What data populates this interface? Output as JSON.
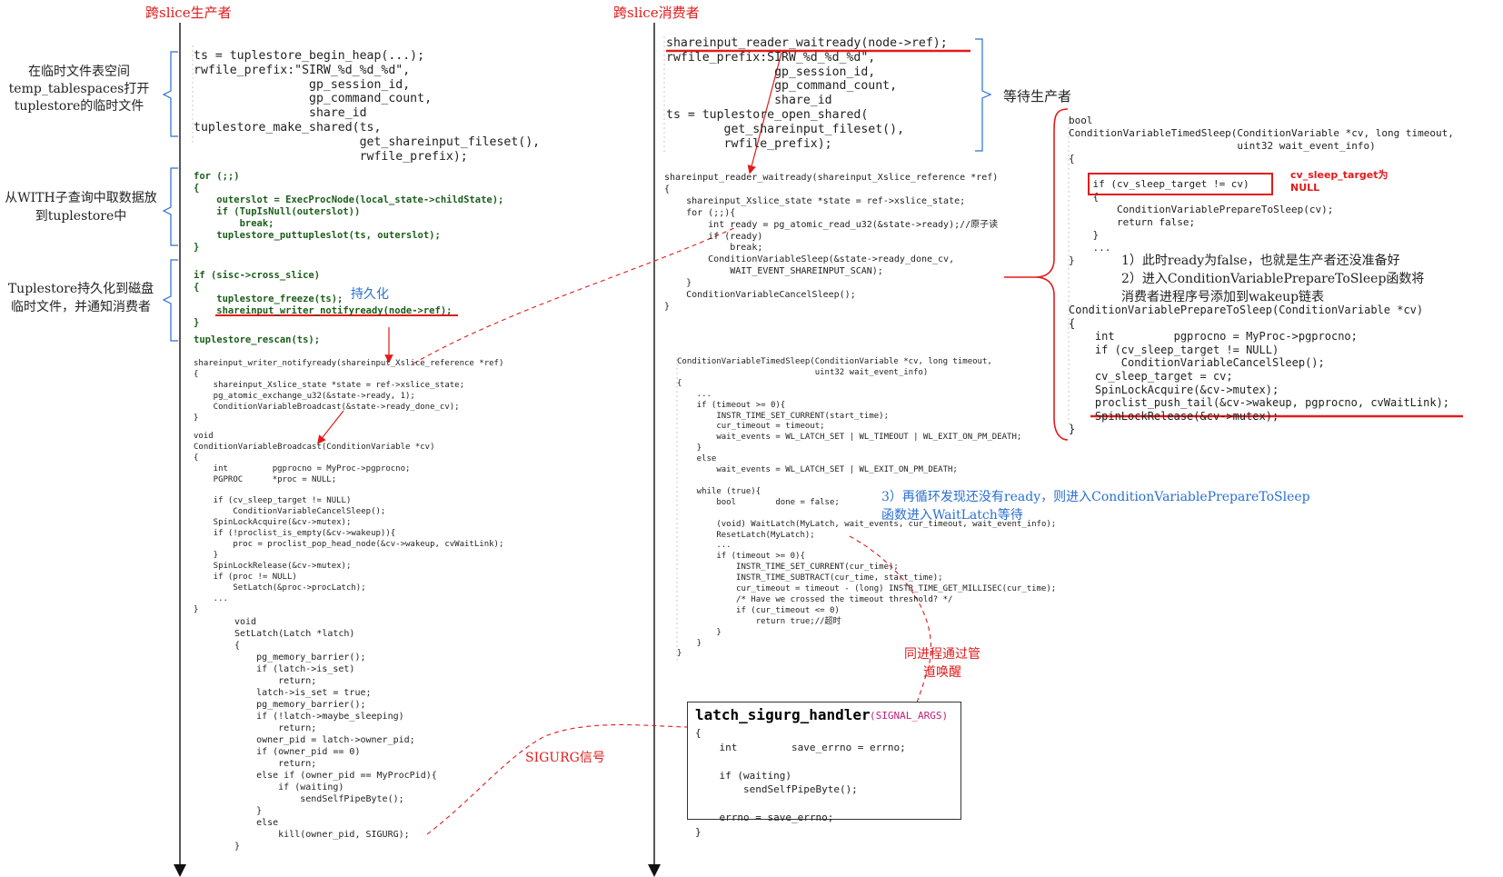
{
  "titles": {
    "producer": "跨slice生产者",
    "consumer": "跨slice消费者"
  },
  "left_notes": {
    "n1": "在临时文件表空间\ntemp_tablespaces打开\ntuplestore的临时文件",
    "n2": "从WITH子查询中取数据放\n到tuplestore中",
    "n3": "Tuplestore持久化到磁盘\n临时文件，并通知消费者"
  },
  "producer_code": {
    "block1": "ts = tuplestore_begin_heap(...);\nrwfile_prefix:\"SIRW_%d_%d_%d\",\n                gp_session_id,\n                gp_command_count,\n                share_id\ntuplestore_make_shared(ts,\n                       get_shareinput_fileset(),\n                       rwfile_prefix);",
    "block2": "for (;;)\n{\n    outerslot = ExecProcNode(local_state->childState);\n    if (TupIsNull(outerslot))\n        break;\n    tuplestore_puttupleslot(ts, outerslot);\n}",
    "block3": "if (sisc->cross_slice)\n{\n    tuplestore_freeze(ts);\n    shareinput_writer_notifyready(node->ref);\n}",
    "persist_note": "持久化",
    "rescan": "tuplestore_rescan(ts);",
    "block4": "shareinput_writer_notifyready(shareinput_Xslice_reference *ref)\n{\n    shareinput_Xslice_state *state = ref->xslice_state;\n    pg_atomic_exchange_u32(&state->ready, 1);\n    ConditionVariableBroadcast(&state->ready_done_cv);\n}",
    "block5": "void\nConditionVariableBroadcast(ConditionVariable *cv)\n{\n    int         pgprocno = MyProc->pgprocno;\n    PGPROC      *proc = NULL;\n\n    if (cv_sleep_target != NULL)\n        ConditionVariableCancelSleep();\n    SpinLockAcquire(&cv->mutex);\n    if (!proclist_is_empty(&cv->wakeup)){\n        proc = proclist_pop_head_node(&cv->wakeup, cvWaitLink);\n    }\n    SpinLockRelease(&cv->mutex);\n    if (proc != NULL)\n        SetLatch(&proc->procLatch);\n    ...\n}",
    "block6": "void\nSetLatch(Latch *latch)\n{\n    pg_memory_barrier();\n    if (latch->is_set)\n        return;\n    latch->is_set = true;\n    pg_memory_barrier();\n    if (!latch->maybe_sleeping)\n        return;\n    owner_pid = latch->owner_pid;\n    if (owner_pid == 0)\n        return;\n    else if (owner_pid == MyProcPid){\n        if (waiting)\n            sendSelfPipeByte();\n    }\n    else\n        kill(owner_pid, SIGURG);\n}"
  },
  "sigurg_note": "SIGURG信号",
  "consumer_code": {
    "block1": "shareinput_reader_waitready(node->ref);\nrwfile_prefix:SIRW_%d_%d_%d\",\n               gp_session_id,\n               gp_command_count,\n               share_id\nts = tuplestore_open_shared(\n        get_shareinput_fileset(),\n        rwfile_prefix);",
    "wait_note": "等待生产者",
    "block2": "shareinput_reader_waitready(shareinput_Xslice_reference *ref)\n{\n    shareinput_Xslice_state *state = ref->xslice_state;\n    for (;;){\n        int ready = pg_atomic_read_u32(&state->ready);//原子读\n        if (ready)\n            break;\n        ConditionVariableSleep(&state->ready_done_cv,\n            WAIT_EVENT_SHAREINPUT_SCAN);\n    }\n    ConditionVariableCancelSleep();\n}",
    "block3": "ConditionVariableTimedSleep(ConditionVariable *cv, long timeout,\n                            uint32 wait_event_info)\n{\n    ...\n    if (timeout >= 0){\n        INSTR_TIME_SET_CURRENT(start_time);\n        cur_timeout = timeout;\n        wait_events = WL_LATCH_SET | WL_TIMEOUT | WL_EXIT_ON_PM_DEATH;\n    }\n    else\n        wait_events = WL_LATCH_SET | WL_EXIT_ON_PM_DEATH;\n\n    while (true){\n        bool        done = false;\n\n        (void) WaitLatch(MyLatch, wait_events, cur_timeout, wait_event_info);\n        ResetLatch(MyLatch);\n        ...\n        if (timeout >= 0){\n            INSTR_TIME_SET_CURRENT(cur_time);\n            INSTR_TIME_SUBTRACT(cur_time, start_time);\n            cur_timeout = timeout - (long) INSTR_TIME_GET_MILLISEC(cur_time);\n            /* Have we crossed the timeout threshold? */\n            if (cur_timeout <= 0)\n                return true;//超时\n        }\n    }\n}",
    "note3": "3）再循环发现还没有ready，则进入ConditionVariablePrepareToSleep\n函数进入WaitLatch等待",
    "wakeup_note": "同进程通过管\n道唤醒",
    "handler_title": "latch_sigurg_handler",
    "handler_args": "(SIGNAL_ARGS)",
    "handler_body": "{\n    int         save_errno = errno;\n\n    if (waiting)\n        sendSelfPipeByte();\n\n    errno = save_errno;\n}"
  },
  "right_code": {
    "block1": "bool\nConditionVariableTimedSleep(ConditionVariable *cv, long timeout,\n                            uint32 wait_event_info)\n{\n\n    if (cv_sleep_target != cv)\n    {\n        ConditionVariablePrepareToSleep(cv);\n        return false;\n    }\n    ...\n}",
    "sleep_target_note": "cv_sleep_target为\nNULL",
    "notes12": "1）此时ready为false，也就是生产者还没准备好\n2）进入ConditionVariablePrepareToSleep函数将\n消费者进程序号添加到wakeup链表",
    "block2": "ConditionVariablePrepareToSleep(ConditionVariable *cv)\n{\n    int         pgprocno = MyProc->pgprocno;\n    if (cv_sleep_target != NULL)\n        ConditionVariableCancelSleep();\n    cv_sleep_target = cv;\n    SpinLockAcquire(&cv->mutex);\n    proclist_push_tail(&cv->wakeup, pgprocno, cvWaitLink);\n    SpinLockRelease(&cv->mutex);\n}"
  },
  "colors": {
    "accent": "#e21b1b",
    "note_blue": "#2a6fd1",
    "axis": "#111111"
  }
}
